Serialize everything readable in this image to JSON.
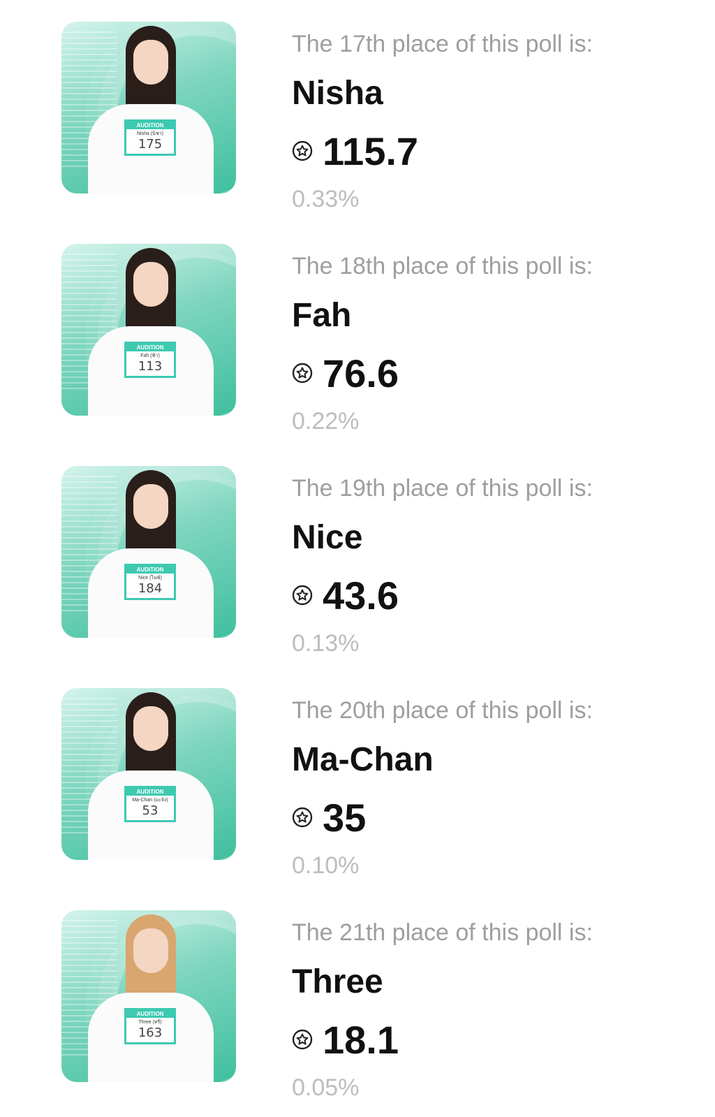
{
  "poll_results": [
    {
      "place_text": "The 17th place of this poll is:",
      "name": "Nisha",
      "score": "115.7",
      "percent": "0.33%",
      "badge_name": "Nisha (นิชา)",
      "badge_header": "AUDITION",
      "badge_number": "175",
      "hair": "dark"
    },
    {
      "place_text": "The 18th place of this poll is:",
      "name": "Fah",
      "score": "76.6",
      "percent": "0.22%",
      "badge_name": "Fah (ฟ้า)",
      "badge_header": "AUDITION",
      "badge_number": "113",
      "hair": "dark"
    },
    {
      "place_text": "The 19th place of this poll is:",
      "name": "Nice",
      "score": "43.6",
      "percent": "0.13%",
      "badge_name": "Nice (ไนซ์)",
      "badge_header": "AUDITION",
      "badge_number": "184",
      "hair": "dark"
    },
    {
      "place_text": "The 20th place of this poll is:",
      "name": "Ma-Chan",
      "score": "35",
      "percent": "0.10%",
      "badge_name": "Ma-Chan (มะจัง)",
      "badge_header": "AUDITION",
      "badge_number": "53",
      "hair": "dark"
    },
    {
      "place_text": "The 21th place of this poll is:",
      "name": "Three",
      "score": "18.1",
      "percent": "0.05%",
      "badge_name": "Three (ทรี)",
      "badge_header": "AUDITION",
      "badge_number": "163",
      "hair": "light"
    }
  ],
  "colors": {
    "place_text": "#9e9e9e",
    "name": "#111111",
    "percent": "#bdbdbd",
    "photo_accent": "#3ec9b1"
  },
  "icons": {
    "score": "star-badge-icon"
  }
}
